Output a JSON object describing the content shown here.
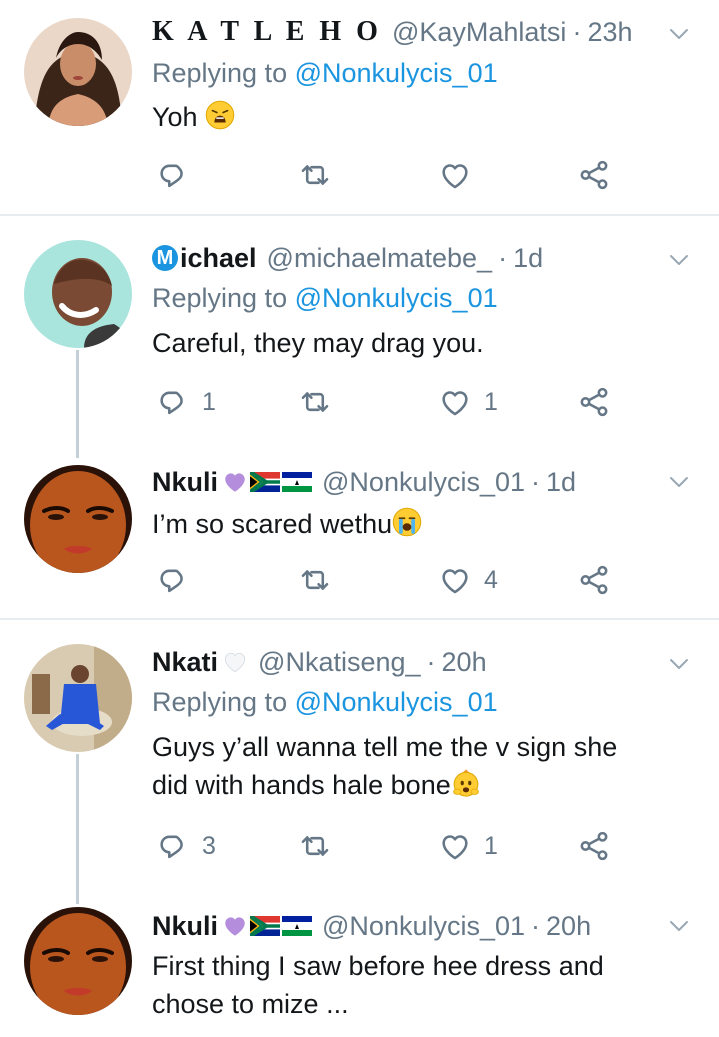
{
  "tweets": [
    {
      "display_name": "K A T L E H O",
      "handle": "@KayMahlatsi",
      "time": "23h",
      "reply_prefix": "Replying to ",
      "reply_mention": "@Nonkulycis_01",
      "text": "Yoh",
      "replies": "",
      "likes": ""
    },
    {
      "display_name": "ichael",
      "name_badge": "M",
      "handle": "@michaelmatebe_",
      "time": "1d",
      "reply_prefix": "Replying to ",
      "reply_mention": "@Nonkulycis_01",
      "text": "Careful, they may drag you.",
      "replies": "1",
      "likes": "1"
    },
    {
      "display_name": "Nkuli",
      "handle": "@Nonkulycis_01",
      "time": "1d",
      "text": "I’m so scared wethu",
      "replies": "",
      "likes": "4"
    },
    {
      "display_name": "Nkati",
      "handle": "@Nkatiseng_",
      "time": "20h",
      "reply_prefix": "Replying to ",
      "reply_mention": "@Nonkulycis_01",
      "text_line1": "Guys y’all wanna tell me the v sign she",
      "text_line2": "did with hands hale bone",
      "replies": "3",
      "likes": "1"
    },
    {
      "display_name": "Nkuli",
      "handle": "@Nonkulycis_01",
      "time": "20h",
      "text_line1": "First thing I saw before hee dress and",
      "text_line2": "chose to mize ..."
    }
  ],
  "separator": "·",
  "icons": {
    "reply": "reply-icon",
    "retweet": "retweet-icon",
    "like": "heart-icon",
    "share": "share-icon",
    "more": "chevron-down-icon"
  },
  "colors": {
    "link": "#1b95e0",
    "muted": "#657786",
    "text": "#14171a",
    "divider": "#e6ecf0",
    "thread_line": "#c4cfd6"
  }
}
